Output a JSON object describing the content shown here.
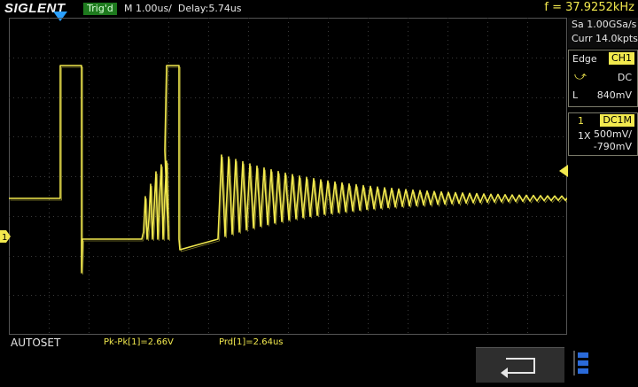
{
  "header": {
    "brand": "SIGLENT",
    "trigger_state": "Trig'd",
    "timebase": "M 1.00us/",
    "delay": "Delay:5.74us",
    "frequency": "f = 37.9252kHz"
  },
  "acquisition": {
    "sample_rate": "Sa 1.00GSa/s",
    "memory": "Curr 14.0kpts"
  },
  "trigger": {
    "type": "Edge",
    "source": "CH1",
    "slope_icon": "rising-edge-icon",
    "coupling": "DC",
    "level_label": "L",
    "level": "840mV"
  },
  "channel": {
    "number": "1",
    "coupling": "DC1M",
    "probe": "1X",
    "volts_div": "500mV/",
    "offset": "-790mV"
  },
  "bottom": {
    "mode": "AUTOSET",
    "measurements": [
      "Pk-Pk[1]=2.66V",
      "Prd[1]=2.64us"
    ]
  },
  "colors": {
    "trace": "#f2e94e",
    "trigger_marker": "#2aa0ff",
    "trig_state_bg": "#1e7a1e",
    "grid": "#3a3a3a"
  },
  "icons": {
    "softkey": "return-arrow-icon",
    "menu": "menu-toggle-icon"
  }
}
